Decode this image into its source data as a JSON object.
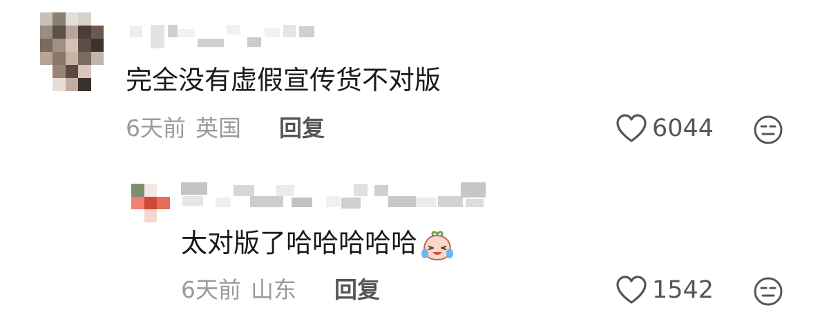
{
  "comments": [
    {
      "text": "完全没有虚假宣传货不对版",
      "time": "6天前",
      "location": "英国",
      "reply_label": "回复",
      "likes": "6044"
    },
    {
      "text": "太对版了哈哈哈哈哈",
      "emoji": "laughing-crying-emoji",
      "time": "6天前",
      "location": "山东",
      "reply_label": "回复",
      "likes": "1542"
    }
  ],
  "icons": {
    "like": "heart-outline-icon",
    "dislike": "meh-face-icon"
  },
  "colors": {
    "text": "#1a1a1a",
    "meta": "#9a9a9a",
    "action": "#555555"
  }
}
